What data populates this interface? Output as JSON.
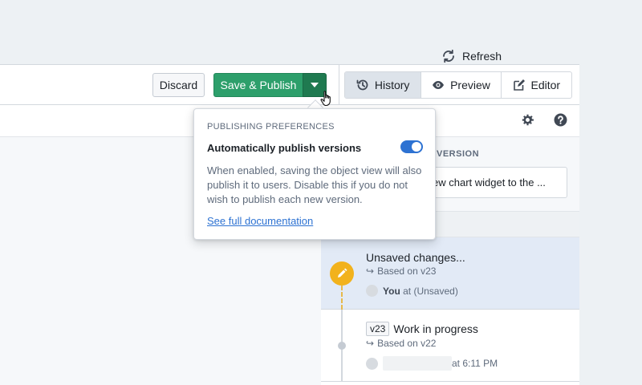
{
  "header": {
    "discard_label": "Discard",
    "publish_label": "Save & Publish",
    "tabs": [
      {
        "label": "History",
        "icon": "history-icon",
        "active": true
      },
      {
        "label": "Preview",
        "icon": "eye-icon",
        "active": false
      },
      {
        "label": "Editor",
        "icon": "edit-icon",
        "active": false
      }
    ]
  },
  "toolbar": {
    "refresh_label": "Refresh",
    "settings_icon": "gear-icon",
    "help_icon": "help-icon"
  },
  "popover": {
    "heading": "PUBLISHING PREFERENCES",
    "toggle_label": "Automatically publish versions",
    "toggle_on": true,
    "description": "When enabled, saving the object view will also publish it to users. Disable this if you do not wish to publish each new version.",
    "link_label": "See full documentation"
  },
  "panel": {
    "section_heading": "VERSION",
    "version_text": "ew chart widget to the ...",
    "unsaved": {
      "title": "Unsaved changes...",
      "based_on": "Based on v23",
      "user": "You",
      "user_suffix": "at (Unsaved)"
    },
    "v23": {
      "tag": "v23",
      "title": "Work in progress",
      "based_on": "Based on v22",
      "time": "at 6:11 PM"
    }
  },
  "colors": {
    "publish_green": "#2d9f6b",
    "accent_blue": "#2d72d2",
    "pending_orange": "#f2b21c"
  }
}
